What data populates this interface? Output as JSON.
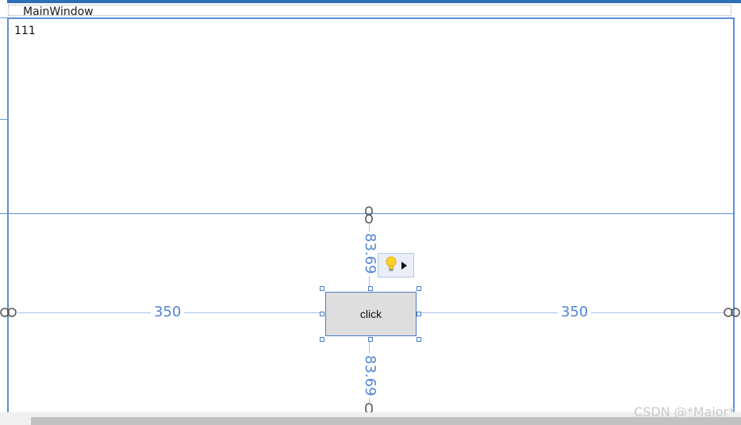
{
  "window": {
    "title": "MainWindow"
  },
  "content": {
    "label_text": "111",
    "button_label": "click"
  },
  "margins": {
    "left": "350",
    "right": "350",
    "top": "83.69",
    "bottom": "83.69"
  },
  "watermark": "CSDN @*Major*",
  "icons": {
    "anchor": "chain-link-icon",
    "smart_tag": "lightbulb-icon",
    "smart_tag_arrow": "triangle-right-icon"
  },
  "colors": {
    "accent": "#5a8fd6",
    "margin_text": "#4f87d4",
    "button_bg": "#dedede"
  }
}
